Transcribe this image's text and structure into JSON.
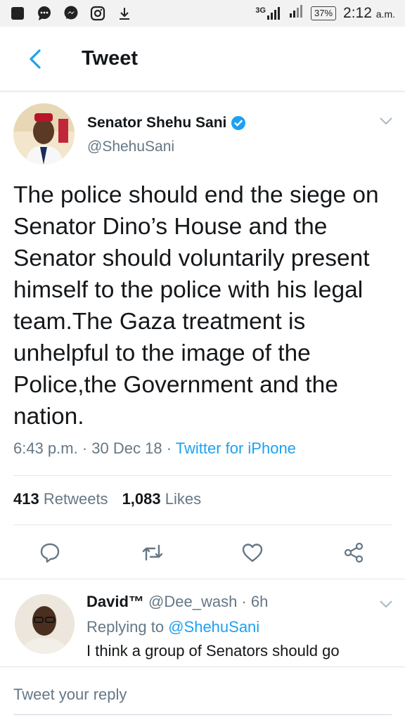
{
  "status_bar": {
    "network_label": "3G",
    "battery": "37%",
    "time": "2:12",
    "time_suffix": "a.m.",
    "icons": [
      "stop-square-icon",
      "chat-bubble-icon",
      "messenger-icon",
      "instagram-icon",
      "download-icon",
      "signal-icon",
      "signal-icon-2",
      "battery-icon"
    ]
  },
  "header": {
    "title": "Tweet"
  },
  "tweet": {
    "author_name": "Senator Shehu Sani",
    "verified": true,
    "handle": "@ShehuSani",
    "text": "The police should end the siege on Senator Dino’s House and the Senator should voluntarily present himself to the police with his legal team.The Gaza treatment is unhelpful to the image of the Police,the Government and the nation.",
    "time": "6:43 p.m.",
    "date": "30 Dec 18",
    "source": "Twitter for iPhone",
    "retweets_count": "413",
    "retweets_label": "Retweets",
    "likes_count": "1,083",
    "likes_label": "Likes"
  },
  "reply": {
    "name": "David™",
    "handle": "@Dee_wash",
    "age": "6h",
    "replying_label": "Replying to",
    "replying_to": "@ShehuSani",
    "text": "I think a group of Senators should go"
  },
  "compose": {
    "placeholder": "Tweet your reply"
  },
  "colors": {
    "accent": "#1da1f2",
    "muted": "#657786",
    "text": "#14171a",
    "divider": "#e1e8ed"
  }
}
